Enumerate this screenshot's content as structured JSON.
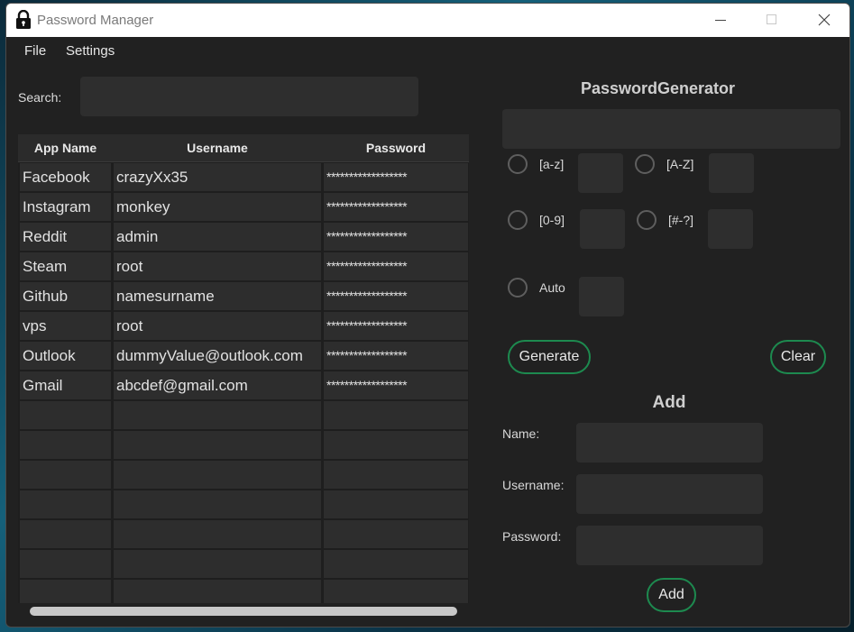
{
  "window": {
    "title": "Password Manager"
  },
  "menu": {
    "file": "File",
    "settings": "Settings"
  },
  "search": {
    "label": "Search:",
    "value": ""
  },
  "table": {
    "headers": [
      "App Name",
      "Username",
      "Password"
    ],
    "rows": [
      [
        "Facebook",
        "crazyXx35",
        "******************"
      ],
      [
        "Instagram",
        "monkey",
        "******************"
      ],
      [
        "Reddit",
        "admin",
        "******************"
      ],
      [
        "Steam",
        "root",
        "******************"
      ],
      [
        "Github",
        "namesurname",
        "******************"
      ],
      [
        "vps",
        "root",
        "******************"
      ],
      [
        "Outlook",
        "dummyValue@outlook.com",
        "******************"
      ],
      [
        "Gmail",
        "abcdef@gmail.com",
        "******************"
      ],
      [
        "",
        "",
        ""
      ],
      [
        "",
        "",
        ""
      ],
      [
        "",
        "",
        ""
      ],
      [
        "",
        "",
        ""
      ],
      [
        "",
        "",
        ""
      ],
      [
        "",
        "",
        ""
      ],
      [
        "",
        "",
        ""
      ]
    ]
  },
  "generator": {
    "title": "PasswordGenerator",
    "output": "",
    "options": {
      "lower": "[a-z]",
      "upper": "[A-Z]",
      "digits": "[0-9]",
      "symbols": "[#-?]",
      "auto": "Auto"
    },
    "generate_label": "Generate",
    "clear_label": "Clear"
  },
  "add": {
    "title": "Add",
    "name_label": "Name:",
    "username_label": "Username:",
    "password_label": "Password:",
    "button_label": "Add"
  },
  "colors": {
    "accent": "#1d8a4f",
    "background": "#212121",
    "field": "#2e2e2e"
  }
}
